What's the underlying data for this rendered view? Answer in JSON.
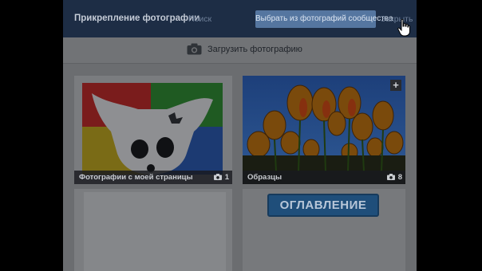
{
  "header": {
    "title": "Прикрепление фотографии",
    "search_label": "Поиск",
    "community_button_label": "Выбрать из фотографий сообщества",
    "close_label": "Закрыть"
  },
  "upload": {
    "label": "Загрузить фотографию",
    "icon": "camera-icon"
  },
  "albums": [
    {
      "name": "Фотографии с моей страницы",
      "count": "1",
      "thumbnail": "dog-logo-on-colored-squares"
    },
    {
      "name": "Образцы",
      "count": "8",
      "thumbnail": "orange-tulips-blue-sky",
      "add_label": "+"
    },
    {
      "name": "",
      "count": "",
      "thumbnail": ""
    },
    {
      "name": "",
      "count": "",
      "thumbnail": "toc-banner",
      "banner_text": "ОГЛАВЛЕНИЕ"
    }
  ],
  "colors": {
    "header_bg": "#1d2d45",
    "button_bg": "#5576a0",
    "overlay": "#000000"
  }
}
